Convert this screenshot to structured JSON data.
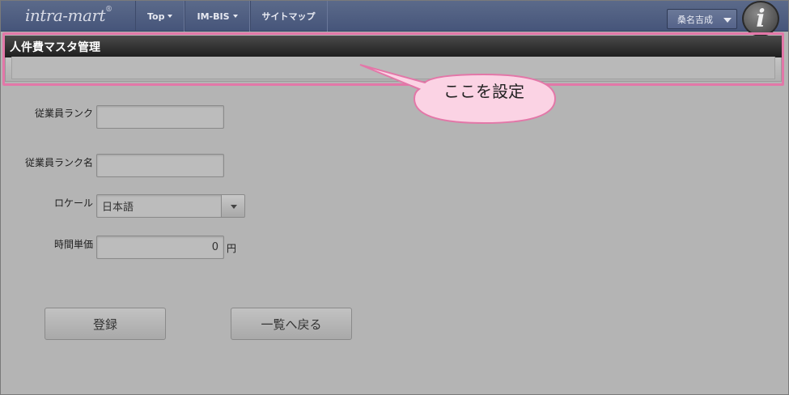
{
  "app": {
    "logo_text": "intra-mart",
    "logo_mark": "®"
  },
  "nav": {
    "items": [
      {
        "label": "Top"
      },
      {
        "label": "IM-BIS"
      },
      {
        "label": "サイトマップ"
      }
    ],
    "user_name": "桑名吉成",
    "info_icon_glyph": "i"
  },
  "page": {
    "title": "人件費マスタ管理"
  },
  "callout": {
    "text": "ここを設定"
  },
  "form": {
    "rank_label": "従業員ランク",
    "rank_value": "",
    "rank_name_label": "従業員ランク名",
    "rank_name_value": "",
    "locale_label": "ロケール",
    "locale_value": "日本語",
    "hourly_label": "時間単価",
    "hourly_value": "0",
    "hourly_unit": "円"
  },
  "buttons": {
    "register": "登録",
    "back": "一覧へ戻る"
  },
  "colors": {
    "highlight": "#e377a8",
    "callout_fill": "#fbd3e4",
    "navbar": "#4f5d80"
  }
}
